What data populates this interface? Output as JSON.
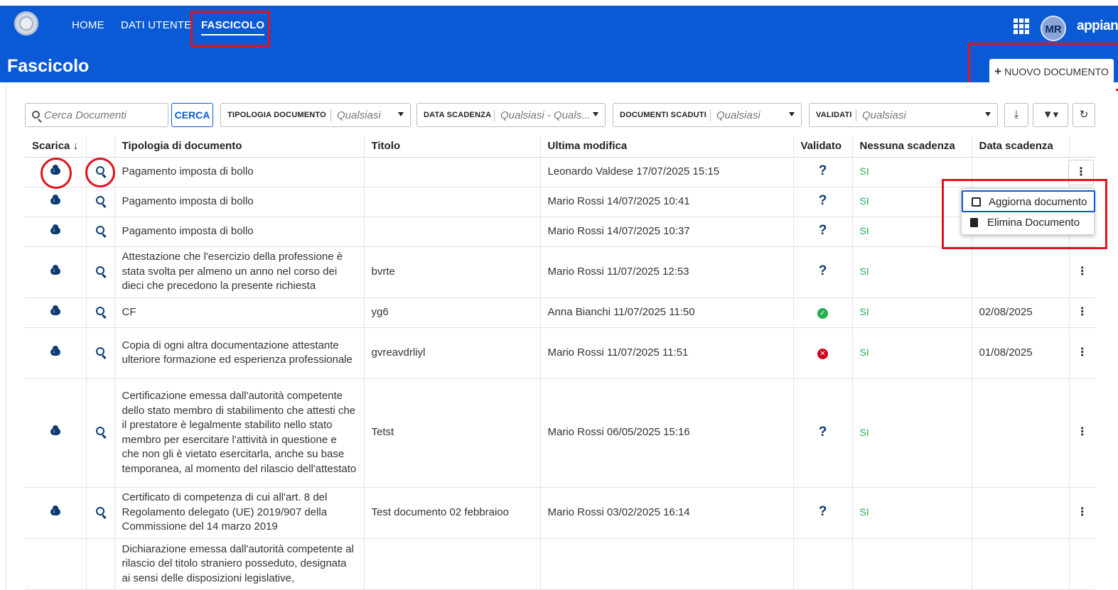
{
  "nav": {
    "items": [
      "HOME",
      "DATI UTENTE",
      "FASCICOLO"
    ],
    "active": "FASCICOLO"
  },
  "header": {
    "avatar_initials": "MR",
    "brand": "appian",
    "page_title": "Fascicolo",
    "new_button_label": "NUOVO DOCUMENTO",
    "new_button_icon": "plus-icon"
  },
  "filters": {
    "search_placeholder": "Cerca Documenti",
    "search_button": "CERCA",
    "tipologia": {
      "label": "TIPOLOGIA DOCUMENTO",
      "value": "Qualsiasi"
    },
    "data_scadenza": {
      "label": "DATA SCADENZA",
      "value": "Qualsiasi - Quals..."
    },
    "documenti_scaduti": {
      "label": "DOCUMENTI SCADUTI",
      "value": "Qualsiasi"
    },
    "validati": {
      "label": "VALIDATI",
      "value": "Qualsiasi"
    }
  },
  "table": {
    "headers": [
      "Scarica ↓",
      "",
      "Tipologia di documento",
      "Titolo",
      "Ultima modifica",
      "Validato",
      "Nessuna scadenza",
      "Data scadenza",
      ""
    ],
    "rows": [
      {
        "tipologia": "Pagamento imposta di bollo",
        "titolo": "",
        "modifica": "Leonardo Valdese 17/07/2025 15:15",
        "validato": "?",
        "nessuna_scadenza": "SI",
        "data_scadenza": ""
      },
      {
        "tipologia": "Pagamento imposta di bollo",
        "titolo": "",
        "modifica": "Mario Rossi 14/07/2025 10:41",
        "validato": "?",
        "nessuna_scadenza": "SI",
        "data_scadenza": ""
      },
      {
        "tipologia": "Pagamento imposta di bollo",
        "titolo": "",
        "modifica": "Mario Rossi 14/07/2025 10:37",
        "validato": "?",
        "nessuna_scadenza": "SI",
        "data_scadenza": ""
      },
      {
        "tipologia": "Attestazione che l'esercizio della professione è stata svolta per almeno un anno nel corso dei dieci che precedono la presente richiesta",
        "titolo": "bvrte",
        "modifica": "Mario Rossi 11/07/2025 12:53",
        "validato": "?",
        "nessuna_scadenza": "SI",
        "data_scadenza": ""
      },
      {
        "tipologia": "CF",
        "titolo": "yg6",
        "modifica": "Anna Bianchi 11/07/2025 11:50",
        "validato": "ok",
        "nessuna_scadenza": "SI",
        "data_scadenza": "02/08/2025"
      },
      {
        "tipologia": "Copia di ogni altra documentazione attestante ulteriore formazione ed esperienza professionale",
        "titolo": "gvreavdrliyl",
        "modifica": "Mario Rossi 11/07/2025 11:51",
        "validato": "ko",
        "nessuna_scadenza": "SI",
        "data_scadenza": "01/08/2025"
      },
      {
        "tipologia": "Certificazione emessa dall'autorità competente dello stato membro di stabilimento che attesti che il prestatore è legalmente stabilito nello stato membro per esercitare l'attività in questione e che non gli è vietato esercitarla, anche su base temporanea, al momento del rilascio dell'attestato",
        "titolo": "Tetst",
        "modifica": "Mario Rossi 06/05/2025 15:16",
        "validato": "?",
        "nessuna_scadenza": "SI",
        "data_scadenza": ""
      },
      {
        "tipologia": "Certificato di competenza di cui all'art. 8 del Regolamento delegato (UE) 2019/907 della Commissione del 14 marzo 2019",
        "titolo": "Test documento 02 febbraioo",
        "modifica": "Mario Rossi 03/02/2025 16:14",
        "validato": "?",
        "nessuna_scadenza": "SI",
        "data_scadenza": ""
      },
      {
        "tipologia": "Dichiarazione emessa dall'autorità competente al rilascio del titolo straniero posseduto, designata ai sensi delle disposizioni legislative,",
        "titolo": "",
        "modifica": "",
        "validato": "",
        "nessuna_scadenza": "",
        "data_scadenza": ""
      }
    ]
  },
  "context_menu": {
    "items": [
      "Aggiorna documento",
      "Elimina Documento"
    ]
  },
  "colors": {
    "header_blue": "#0a5ad6",
    "highlight_red": "#e0131f",
    "success_green": "#22b14c",
    "icon_navy": "#0b3b72"
  }
}
